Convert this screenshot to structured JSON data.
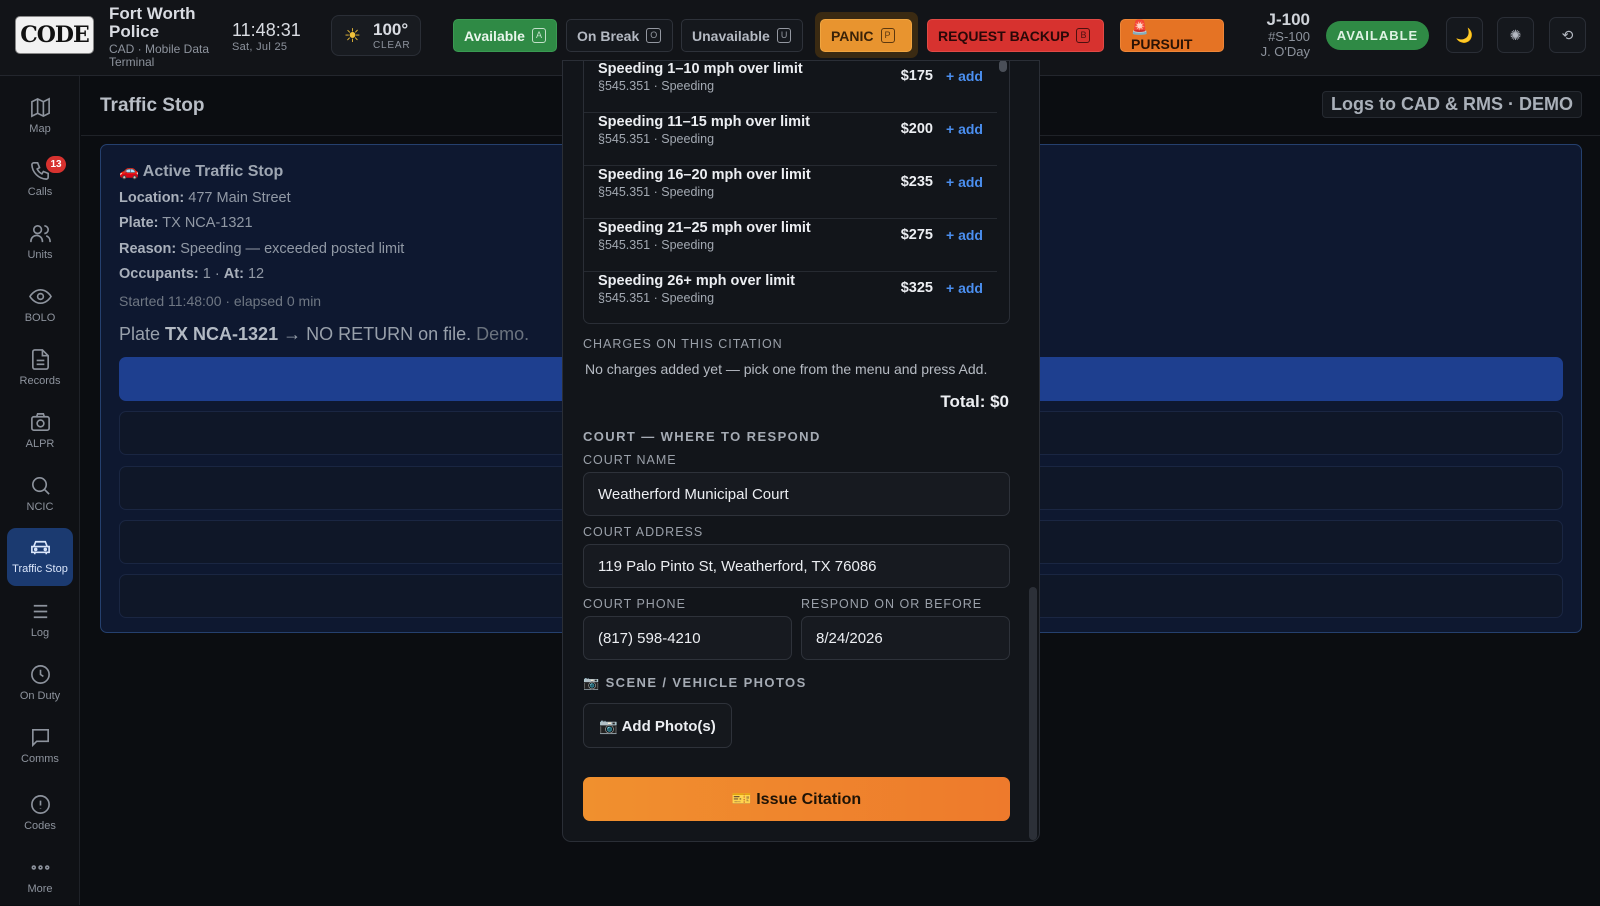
{
  "header": {
    "logo_text": "CODE",
    "agency_name": "Fort Worth Police",
    "agency_sub": "CAD · Mobile Data Terminal",
    "time": "11:48:31",
    "date": "Sat, Jul 25",
    "weather": {
      "temp": "100°",
      "condition": "CLEAR",
      "icon": "sun-icon"
    },
    "status_buttons": [
      {
        "label": "Available",
        "key": "A"
      },
      {
        "label": "On Break",
        "key": "O"
      },
      {
        "label": "Unavailable",
        "key": "U"
      }
    ],
    "panic": {
      "label": "PANIC",
      "key": "P"
    },
    "backup": {
      "label": "REQUEST BACKUP",
      "key": "B"
    },
    "pursuit": {
      "label": "🚨 PURSUIT"
    },
    "unit": {
      "id": "J-100",
      "callsign": "#S-100",
      "officer": "J. O'Day",
      "status": "AVAILABLE"
    },
    "icon_buttons": {
      "theme": "🌙",
      "fan": "✺",
      "reset": "⟲"
    }
  },
  "sidebar": {
    "items": [
      {
        "label": "Map"
      },
      {
        "label": "Calls",
        "badge": "13"
      },
      {
        "label": "Units"
      },
      {
        "label": "BOLO"
      },
      {
        "label": "Records"
      },
      {
        "label": "ALPR"
      },
      {
        "label": "NCIC"
      },
      {
        "label": "Traffic Stop"
      },
      {
        "label": "Log"
      },
      {
        "label": "On Duty"
      },
      {
        "label": "Comms"
      },
      {
        "label": "Codes"
      },
      {
        "label": "More"
      }
    ]
  },
  "page": {
    "title": "Traffic Stop",
    "tag": "Logs to CAD & RMS · DEMO"
  },
  "stop": {
    "title": "🚗 Active Traffic Stop",
    "location_label": "Location:",
    "location": "477 Main Street",
    "plate_label": "Plate:",
    "plate": "TX NCA-1321",
    "reason_label": "Reason:",
    "reason": "Speeding — exceeded posted limit",
    "occupants_label": "Occupants:",
    "occupants": "1",
    "at_label": "At:",
    "at": "12",
    "started": "Started 11:48:00 · elapsed 0 min",
    "plate_result_prefix": "Plate",
    "plate_result_plate": "TX NCA-1321",
    "plate_result_text": "→ NO RETURN on file.",
    "plate_result_demo": "Demo."
  },
  "citation": {
    "charges": [
      {
        "name": "Speeding 1–10 mph over limit",
        "statute": "§545.351 · Speeding",
        "fine": "$175",
        "add": "+ add"
      },
      {
        "name": "Speeding 11–15 mph over limit",
        "statute": "§545.351 · Speeding",
        "fine": "$200",
        "add": "+ add"
      },
      {
        "name": "Speeding 16–20 mph over limit",
        "statute": "§545.351 · Speeding",
        "fine": "$235",
        "add": "+ add"
      },
      {
        "name": "Speeding 21–25 mph over limit",
        "statute": "§545.351 · Speeding",
        "fine": "$275",
        "add": "+ add"
      },
      {
        "name": "Speeding 26+ mph over limit",
        "statute": "§545.351 · Speeding",
        "fine": "$325",
        "add": "+ add"
      }
    ],
    "charges_label": "CHARGES ON THIS CITATION",
    "charges_empty": "No charges added yet — pick one from the menu and press Add.",
    "total": "Total: $0",
    "court_heading": "COURT — WHERE TO RESPOND",
    "court_name_label": "COURT NAME",
    "court_name": "Weatherford Municipal Court",
    "court_address_label": "COURT ADDRESS",
    "court_address": "119 Palo Pinto St, Weatherford, TX 76086",
    "court_phone_label": "COURT PHONE",
    "court_phone": "(817) 598-4210",
    "respond_label": "RESPOND ON OR BEFORE",
    "respond_date": "8/24/2026",
    "photos_heading": "📷 SCENE / VEHICLE PHOTOS",
    "add_photo": "📷 Add Photo(s)",
    "issue": "🎫 Issue Citation"
  }
}
